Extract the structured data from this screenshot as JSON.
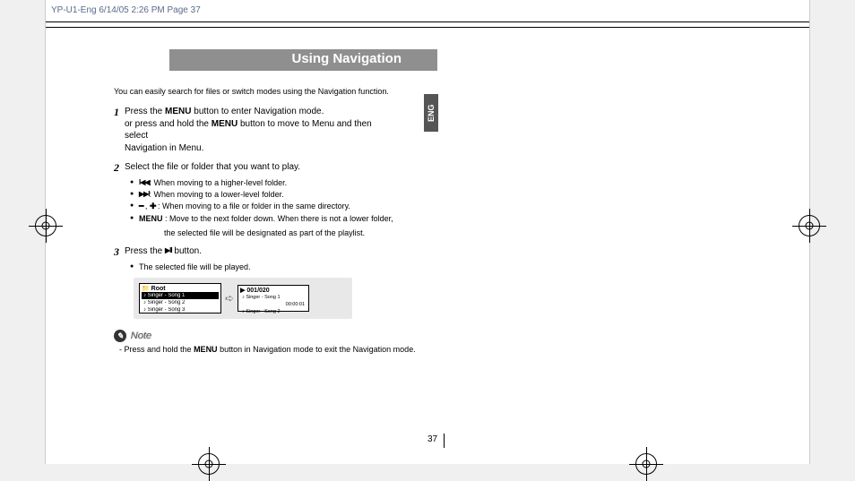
{
  "header": {
    "crop": "YP-U1-Eng  6/14/05 2:26 PM  Page 37"
  },
  "lang_tab": "ENG",
  "title": "Using Navigation",
  "intro": "You can easily search for files or switch modes using the Navigation function.",
  "step1": {
    "num": "1",
    "line1a": "Press the ",
    "menu": "MENU",
    "line1b": " button to enter Navigation mode.",
    "line2a": "or press and hold the ",
    "line2b": " button to move to Menu and then select",
    "line3": "Navigation in Menu."
  },
  "step2": {
    "num": "2",
    "text": "Select the file or folder that you want to play.",
    "b1": ": When moving to a higher-level folder.",
    "b2": ": When moving to a lower-level folder.",
    "b3_sep": " , ",
    "b3": " : When moving to a file or folder in the same directory.",
    "b4_label": "MENU",
    "b4": " : Move to the next folder down. When there is not a lower folder,",
    "b4_sub": "the selected file will be designated as part of the playlist."
  },
  "step3": {
    "num": "3",
    "a": "Press the  ",
    "b": "  button.",
    "bul": "The selected file will be played."
  },
  "lcd1": {
    "hdr": "Root",
    "r1": "Singer - Song 1",
    "r2": "Singer - Song 2",
    "r3": "Singer - Song 3"
  },
  "lcd2": {
    "hdr": "▶ 001/020",
    "r1": "Singer - Song 1",
    "t": "00:00:01",
    "r2": "Singer - Song 2"
  },
  "note": {
    "badge": "✎",
    "label": "Note",
    "dash": "- Press and hold the ",
    "menu": "MENU",
    "rest": " button in Navigation mode to exit the Navigation mode."
  },
  "page_number": "37"
}
